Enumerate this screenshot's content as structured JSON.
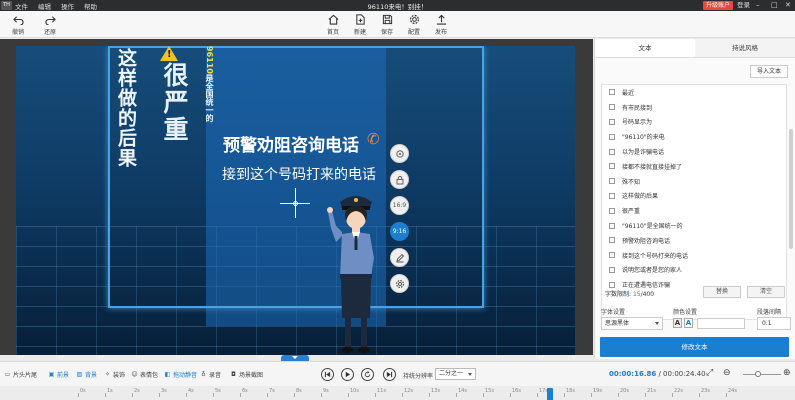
{
  "titlebar": {
    "logo": "TH",
    "menu": [
      "文件",
      "编辑",
      "操作",
      "帮助"
    ],
    "title": "96110来电！别挂！",
    "upgrade": "升级账户",
    "login": "登录"
  },
  "toolbar": {
    "undo": "撤销",
    "redo": "还原",
    "home": "首页",
    "new": "新建",
    "save": "保存",
    "config": "配置",
    "publish": "发布"
  },
  "stage": {
    "vertical_1": "这样做的后果",
    "vertical_2": "很严重",
    "vertical_3_prefix": "96110",
    "vertical_3_suffix": "是全国统一的",
    "line_1": "预警劝阻咨询电话",
    "line_2": "接到这个号码打来的电话"
  },
  "side_buttons": {
    "ratio_169": "16:9",
    "ratio_916": "9:16"
  },
  "right_panel": {
    "tabs": [
      "文本",
      "持说风格"
    ],
    "import_button": "导入文本",
    "items": [
      "最近",
      "有市民接到",
      "号码显示为",
      "\"96110\"的来电",
      "以为是诈骗电话",
      "接都不接就直接挂掉了",
      "殊不知",
      "这样做的后果",
      "很严重",
      "\"96110\"是全国统一的",
      "预警劝阻咨询电话",
      "接到这个号码打来的电话",
      "说明您或者是您的家人",
      "正在遭遇电信诈骗"
    ],
    "count_label": "字数限制: ",
    "count_current": "15",
    "count_max": "/400",
    "replace_button": "替换",
    "clear_button": "清空",
    "font_setting_label": "字体设置",
    "color_setting_label": "颜色设置",
    "spacing_label": "段落间隔",
    "font_value": "思源黑体",
    "spacing_value": "0.1",
    "edit_button": "修改文本"
  },
  "bottombar": {
    "items": [
      "片头片尾",
      "前景",
      "背景",
      "装饰",
      "表情包",
      "拖动静音",
      "录音",
      "场景截图"
    ],
    "ratio_label": "持统分辨率",
    "ratio_value": "二分之一",
    "time_current": "00:00:16.86",
    "time_separator": " / ",
    "time_total": "00:00:24.40"
  },
  "ruler": {
    "ticks": [
      "0s",
      "1s",
      "2s",
      "3s",
      "4s",
      "5s",
      "6s",
      "7s",
      "8s",
      "9s",
      "10s",
      "11s",
      "12s",
      "13s",
      "14s",
      "15s",
      "16s",
      "17s",
      "18s",
      "19s",
      "20s",
      "21s",
      "22s",
      "23s",
      "24s"
    ]
  },
  "colors": {
    "accent": "#1a7fd1",
    "titlebar": "#2b2d31",
    "upgrade": "#e8473b",
    "stage_bg": "#0f3d68",
    "frame": "#4aa3e0",
    "highlight_yellow": "#f2e23a",
    "phone_orange": "#f0883a"
  }
}
